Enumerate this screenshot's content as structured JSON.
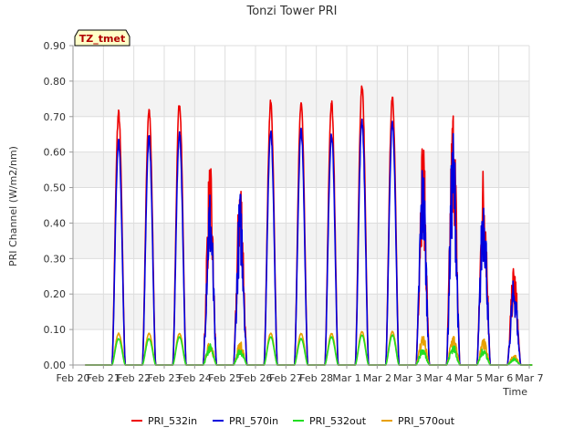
{
  "chart_data": {
    "type": "line",
    "title": "Tonzi Tower PRI",
    "xlabel": "Time",
    "ylabel": "PRI Channel (W/m2/nm)",
    "site_tag": "TZ_tmet",
    "ylim": [
      0,
      0.9
    ],
    "xlim": [
      0,
      15
    ],
    "x_units": "days since Feb 20",
    "y_ticks": [
      "0.00",
      "0.10",
      "0.20",
      "0.30",
      "0.40",
      "0.50",
      "0.60",
      "0.70",
      "0.80",
      "0.90"
    ],
    "x_ticks": [
      "Feb 20",
      "Feb 21",
      "Feb 22",
      "Feb 23",
      "Feb 24",
      "Feb 25",
      "Feb 26",
      "Feb 27",
      "Feb 28",
      "Mar 1",
      "Mar 2",
      "Mar 3",
      "Mar 4",
      "Mar 5",
      "Mar 6",
      "Mar 7"
    ],
    "grid": true,
    "legend_position": "bottom",
    "series": [
      {
        "name": "PRI_532in",
        "color": "#ee0000",
        "daily_peaks": [
          0.72,
          0.73,
          0.75,
          0.58,
          0.56,
          0.75,
          0.75,
          0.75,
          0.8,
          0.77,
          0.66,
          0.76,
          0.59,
          0.29
        ]
      },
      {
        "name": "PRI_570in",
        "color": "#0000dd",
        "daily_peaks": [
          0.64,
          0.65,
          0.66,
          0.51,
          0.5,
          0.67,
          0.67,
          0.66,
          0.7,
          0.69,
          0.59,
          0.68,
          0.52,
          0.25
        ]
      },
      {
        "name": "PRI_532out",
        "color": "#22dd22",
        "daily_peaks": [
          0.075,
          0.075,
          0.08,
          0.06,
          0.05,
          0.08,
          0.075,
          0.08,
          0.085,
          0.085,
          0.05,
          0.06,
          0.05,
          0.02
        ]
      },
      {
        "name": "PRI_570out",
        "color": "#e8a000",
        "daily_peaks": [
          0.09,
          0.09,
          0.09,
          0.07,
          0.07,
          0.09,
          0.09,
          0.09,
          0.095,
          0.095,
          0.09,
          0.09,
          0.075,
          0.03
        ]
      }
    ],
    "day_centers": [
      1.5,
      2.5,
      3.5,
      4.5,
      5.5,
      6.5,
      7.5,
      8.5,
      9.5,
      10.5,
      11.5,
      12.5,
      13.5,
      14.5
    ],
    "day_half_width": 0.22,
    "noisy_days": [
      3,
      4,
      10,
      11,
      12,
      13
    ]
  }
}
